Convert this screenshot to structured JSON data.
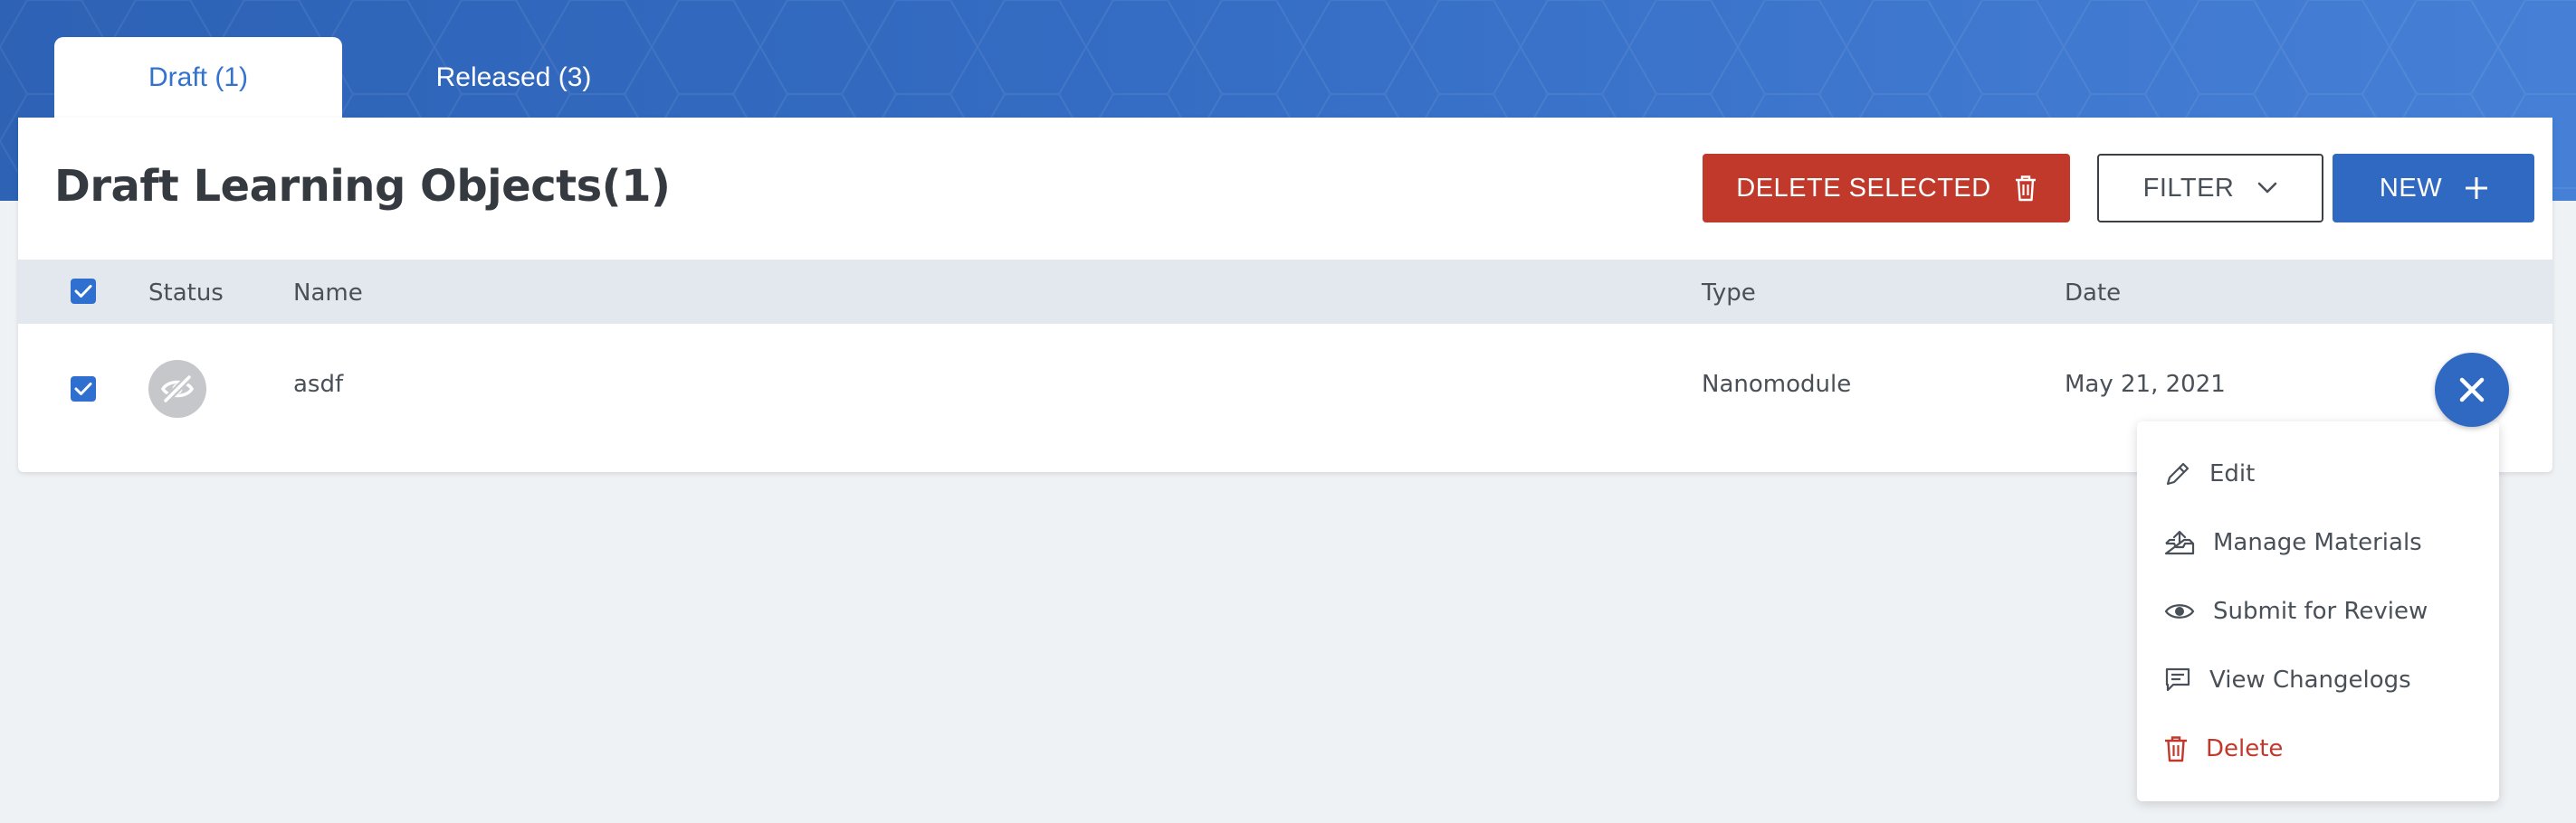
{
  "tabs": [
    {
      "label": "Draft (1)",
      "active": true
    },
    {
      "label": "Released (3)",
      "active": false
    }
  ],
  "page": {
    "title": "Draft Learning Objects(1)"
  },
  "toolbar": {
    "delete_selected_label": "DELETE SELECTED",
    "filter_label": "FILTER",
    "new_label": "NEW"
  },
  "table": {
    "headers": {
      "status": "Status",
      "name": "Name",
      "type": "Type",
      "date": "Date"
    },
    "rows": [
      {
        "selected": true,
        "status_icon": "eye-slash-icon",
        "name": "asdf",
        "type": "Nanomodule",
        "date": "May 21, 2021"
      }
    ]
  },
  "context_menu": {
    "items": [
      {
        "label": "Edit",
        "icon": "pencil-icon"
      },
      {
        "label": "Manage Materials",
        "icon": "upload-tray-icon"
      },
      {
        "label": "Submit for Review",
        "icon": "eye-icon"
      },
      {
        "label": "View Changelogs",
        "icon": "comment-icon"
      },
      {
        "label": "Delete",
        "icon": "trash-icon"
      }
    ]
  },
  "colors": {
    "primary": "#2f69c2",
    "danger": "#c0392b",
    "header_gradient_start": "#2d62b5",
    "header_gradient_end": "#4680d6",
    "background": "#eff2f5",
    "table_header_bg": "#e3e7ee"
  }
}
